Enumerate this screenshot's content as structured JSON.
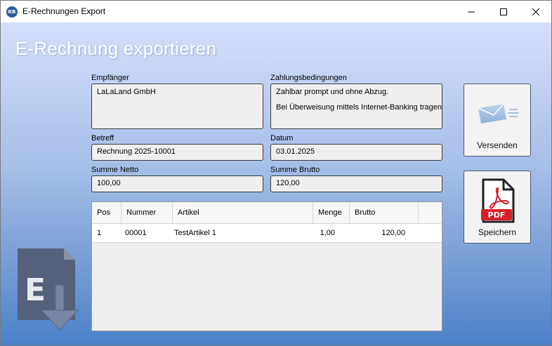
{
  "window": {
    "title": "E-Rechnungen Export",
    "app_icon_text": "KB"
  },
  "heading": "E-Rechnung exportieren",
  "form": {
    "recipient_label": "Empfänger",
    "recipient_value": "LaLaLand GmbH",
    "payment_terms_label": "Zahlungsbedingungen",
    "payment_terms_line1": "Zahlbar prompt und ohne Abzug.",
    "payment_terms_line2": "Bei Überweisung mittels Internet-Banking tragen Sie",
    "subject_label": "Betreff",
    "subject_value": "Rechnung 2025-10001",
    "date_label": "Datum",
    "date_value": "03.01.2025",
    "net_label": "Summe Netto",
    "net_value": "100,00",
    "gross_label": "Summe Brutto",
    "gross_value": "120,00"
  },
  "table": {
    "columns": [
      "Pos",
      "Nummer",
      "Artikel",
      "Menge",
      "Brutto"
    ],
    "rows": [
      {
        "pos": "1",
        "nummer": "00001",
        "artikel": "TestArtikel 1",
        "menge": "1,00",
        "brutto": "120,00"
      }
    ]
  },
  "buttons": {
    "send_label": "Versenden",
    "save_label": "Speichern",
    "pdf_badge": "PDF"
  },
  "logo": {
    "letter": "E"
  },
  "colors": {
    "gradient_top": "#d3defa",
    "gradient_bottom": "#4a81c8",
    "pdf_red": "#d62027",
    "logo_dark": "#55607a"
  }
}
